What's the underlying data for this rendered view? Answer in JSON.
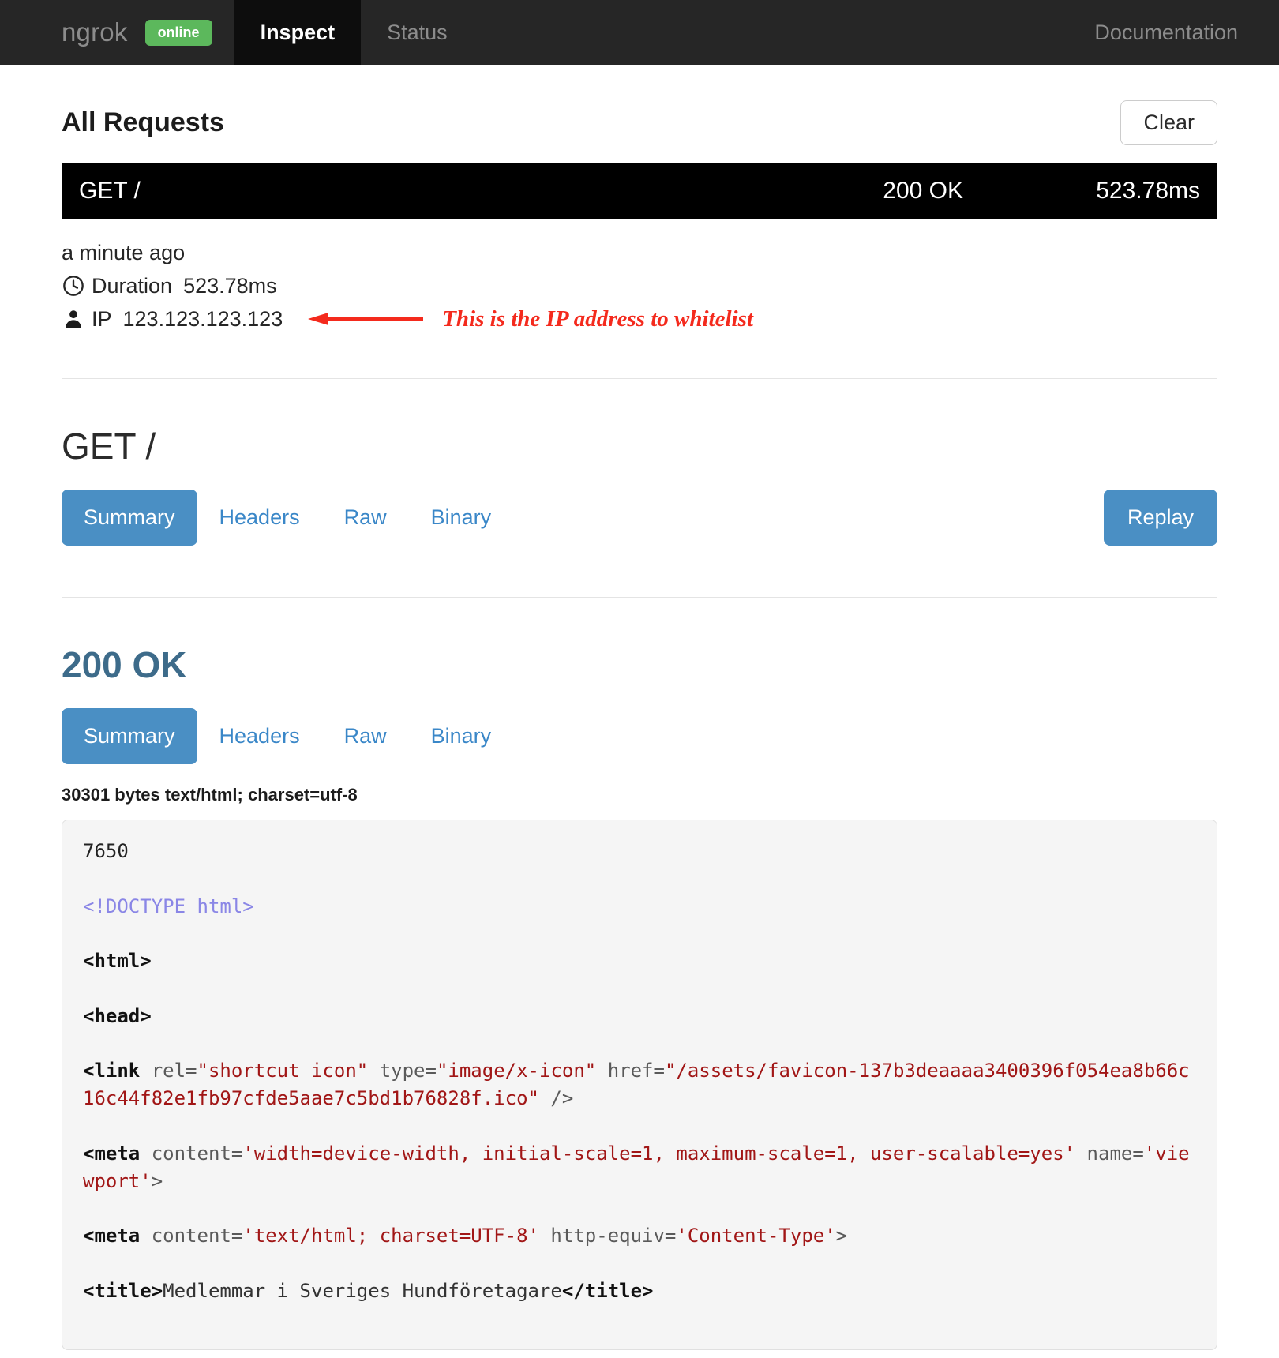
{
  "navbar": {
    "brand": "ngrok",
    "status_badge": "online",
    "items": [
      {
        "label": "Inspect",
        "active": true
      },
      {
        "label": "Status",
        "active": false
      }
    ],
    "documentation": "Documentation",
    "colors": {
      "bar": "#262626",
      "active_tab": "#0d0d0d",
      "badge": "#5cb85c"
    }
  },
  "requests_panel": {
    "title": "All Requests",
    "clear_label": "Clear",
    "row": {
      "method_path": "GET /",
      "status": "200 OK",
      "duration": "523.78ms"
    }
  },
  "meta": {
    "time_ago": "a minute ago",
    "duration_icon": "clock-icon",
    "duration_label": "Duration",
    "duration_value": "523.78ms",
    "ip_icon": "person-icon",
    "ip_label": "IP",
    "ip_value": "123.123.123.123"
  },
  "annotation": {
    "text": "This is the IP address to whitelist",
    "color": "#f42a1d",
    "arrow": "left-arrow-icon"
  },
  "request_detail": {
    "title": "GET /",
    "tabs": [
      {
        "label": "Summary",
        "active": true
      },
      {
        "label": "Headers",
        "active": false
      },
      {
        "label": "Raw",
        "active": false
      },
      {
        "label": "Binary",
        "active": false
      }
    ],
    "replay_label": "Replay"
  },
  "response_detail": {
    "title": "200 OK",
    "tabs": [
      {
        "label": "Summary",
        "active": true
      },
      {
        "label": "Headers",
        "active": false
      },
      {
        "label": "Raw",
        "active": false
      },
      {
        "label": "Binary",
        "active": false
      }
    ],
    "content_type": "30301 bytes text/html; charset=utf-8",
    "body_chunk_size": "7650",
    "body_lines": [
      {
        "doctype": "<!DOCTYPE html>"
      },
      {
        "tag_open": "<html>"
      },
      {
        "tag_open": "<head>"
      },
      {
        "tag": "<link",
        "attrs": " rel=\"shortcut icon\" type=\"image/x-icon\" href=\"/assets/favicon-137b3deaaaa3400396f054ea8b66c16c44f82e1fb97cfde5aae7c5bd1b76828f.ico\" />"
      },
      {
        "tag": "<meta",
        "attrs": " content='width=device-width, initial-scale=1, maximum-scale=1, user-scalable=yes' name='viewport'>"
      },
      {
        "tag": "<meta",
        "attrs": " content='text/html; charset=UTF-8' http-equiv='Content-Type'>"
      },
      {
        "tag": "<title>",
        "text": "Medlemmar i Sveriges Hundföretagare",
        "tag_close": "</title>"
      }
    ]
  },
  "theme": {
    "accent_blue": "#4a8fc4",
    "link_blue": "#3a87c8",
    "response_heading": "#3d6b8a",
    "code_bg": "#f5f5f5",
    "attr_value": "#a11616",
    "doctype": "#8a86e6"
  }
}
